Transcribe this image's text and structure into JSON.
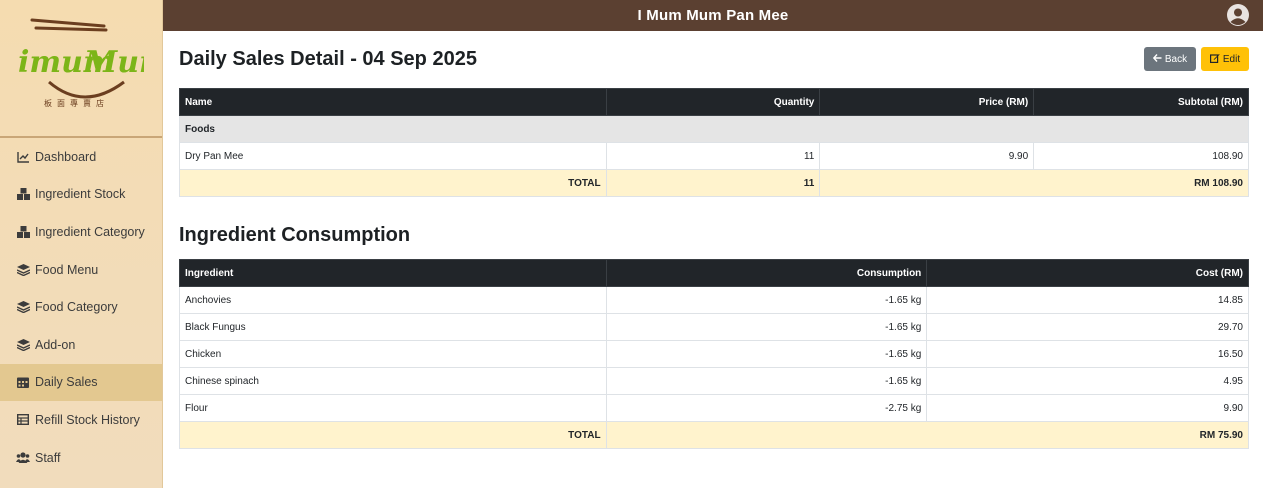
{
  "app": {
    "title": "I Mum Mum Pan Mee"
  },
  "sidebar": {
    "logo_text": "imumMum",
    "logo_subtitle": "板面專賣店",
    "items": [
      {
        "label": "Dashboard",
        "icon": "chart-line-icon",
        "active": false
      },
      {
        "label": "Ingredient Stock",
        "icon": "boxes-icon",
        "active": false
      },
      {
        "label": "Ingredient Category",
        "icon": "boxes-icon",
        "active": false
      },
      {
        "label": "Food Menu",
        "icon": "layers-icon",
        "active": false
      },
      {
        "label": "Food Category",
        "icon": "layers-icon",
        "active": false
      },
      {
        "label": "Add-on",
        "icon": "layers-icon",
        "active": false
      },
      {
        "label": "Daily Sales",
        "icon": "calendar-icon",
        "active": true
      },
      {
        "label": "Refill Stock History",
        "icon": "table-icon",
        "active": false
      },
      {
        "label": "Staff",
        "icon": "users-icon",
        "active": false
      }
    ]
  },
  "header": {
    "user_icon": "user-circle-icon"
  },
  "main": {
    "title": "Daily Sales Detail - 04 Sep 2025",
    "back_label": "Back",
    "edit_label": "Edit",
    "sales": {
      "columns": [
        "Name",
        "Quantity",
        "Price (RM)",
        "Subtotal (RM)"
      ],
      "groups": [
        {
          "name": "Foods",
          "rows": [
            {
              "name": "Dry Pan Mee",
              "quantity": "11",
              "price": "9.90",
              "subtotal": "108.90"
            }
          ]
        }
      ],
      "total_label": "TOTAL",
      "total_quantity": "11",
      "total_subtotal": "RM 108.90"
    },
    "consumption": {
      "title": "Ingredient Consumption",
      "columns": [
        "Ingredient",
        "Consumption",
        "Cost (RM)"
      ],
      "rows": [
        {
          "ingredient": "Anchovies",
          "consumption": "-1.65 kg",
          "cost": "14.85"
        },
        {
          "ingredient": "Black Fungus",
          "consumption": "-1.65 kg",
          "cost": "29.70"
        },
        {
          "ingredient": "Chicken",
          "consumption": "-1.65 kg",
          "cost": "16.50"
        },
        {
          "ingredient": "Chinese spinach",
          "consumption": "-1.65 kg",
          "cost": "4.95"
        },
        {
          "ingredient": "Flour",
          "consumption": "-2.75 kg",
          "cost": "9.90"
        }
      ],
      "total_label": "TOTAL",
      "total_cost": "RM 75.90"
    }
  },
  "colors": {
    "topbar": "#5b4031",
    "sidebar": "#f3dcb6",
    "active_item": "#e3c890",
    "table_header": "#212529",
    "total_row": "#fff3cd",
    "back_button": "#6c757d",
    "edit_button": "#ffc107",
    "logo_green": "#7cb518",
    "logo_brown": "#6b3e1f"
  }
}
